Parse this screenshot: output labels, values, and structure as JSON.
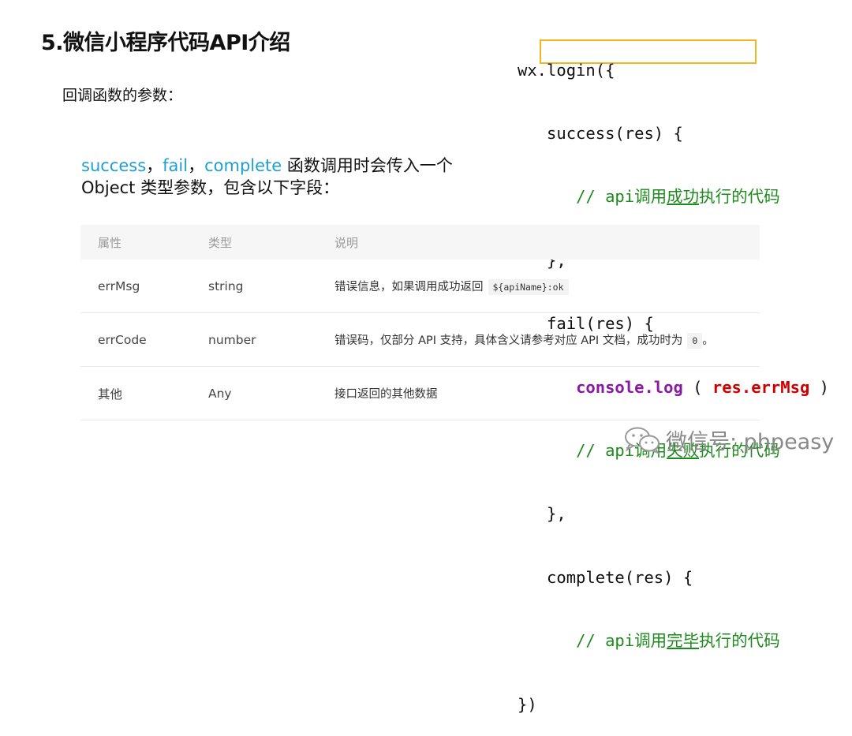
{
  "slide": {
    "title": "5.微信小程序代码API介绍",
    "subtitle": "回调函数的参数：",
    "desc": {
      "kw1": "success",
      "sep1": "，",
      "kw2": "fail",
      "sep2": "，",
      "kw3": "complete",
      "text1": " 函数调用时会传入一个",
      "text2": "Object 类型参数，包含以下字段："
    }
  },
  "code": {
    "l1": "wx.login({",
    "l2": "success(res) {",
    "l3_pre": "// api调用",
    "l3_ul": "成功",
    "l3_post": "执行的代码",
    "l4": "},",
    "l5": "fail(res) {",
    "l6_fn": "console.log",
    "l6_open": " ( ",
    "l6_var": "res.errMsg",
    "l6_close": " )",
    "l7_pre": "// api调用",
    "l7_ul": "失败",
    "l7_post": "执行的代码",
    "l8": "},",
    "l9": "complete(res) {",
    "l10_pre": "// api调用",
    "l10_ul": "完毕",
    "l10_post": "执行的代码",
    "l11": "})"
  },
  "table": {
    "headers": [
      "属性",
      "类型",
      "说明"
    ],
    "rows": [
      {
        "name": "errMsg",
        "type": "string",
        "desc": "错误信息，如果调用成功返回",
        "code": "${apiName}:ok"
      },
      {
        "name": "errCode",
        "type": "number",
        "desc": "错误码，仅部分 API 支持，具体含义请参考对应 API 文档，成功时为",
        "code": "0",
        "tail": "。"
      },
      {
        "name": "其他",
        "type": "Any",
        "desc": "接口返回的其他数据"
      }
    ]
  },
  "watermark": {
    "text": "微信号: phpeasy",
    "icon": "wechat-icon"
  },
  "colors": {
    "keyword": "#1e9fd2",
    "comment": "#1d8a1d",
    "function": "#8a1aa4",
    "variable": "#d00000",
    "highlight_box": "#f2b51d"
  }
}
